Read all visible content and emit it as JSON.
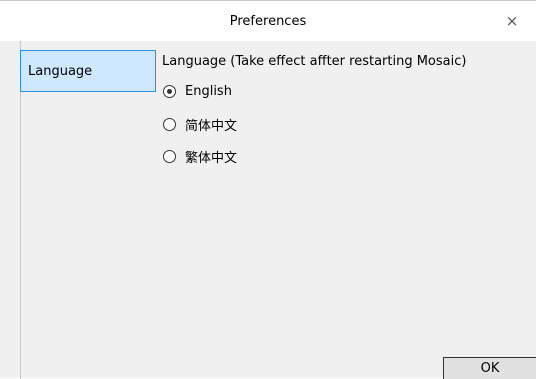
{
  "window": {
    "title": "Preferences",
    "close_glyph": "×"
  },
  "sidebar": {
    "items": [
      {
        "label": "Language",
        "selected": true
      }
    ]
  },
  "language": {
    "section_title": "Language (Take effect affter restarting Mosaic)",
    "options": [
      {
        "label": "English",
        "checked": true
      },
      {
        "label": "简体中文",
        "checked": false
      },
      {
        "label": "繁体中文",
        "checked": false
      }
    ]
  },
  "buttons": {
    "ok_label": "OK"
  },
  "colors": {
    "selection_background": "#cde8ff",
    "selection_border": "#2d90e3",
    "dialog_background": "#f0f0f0"
  }
}
